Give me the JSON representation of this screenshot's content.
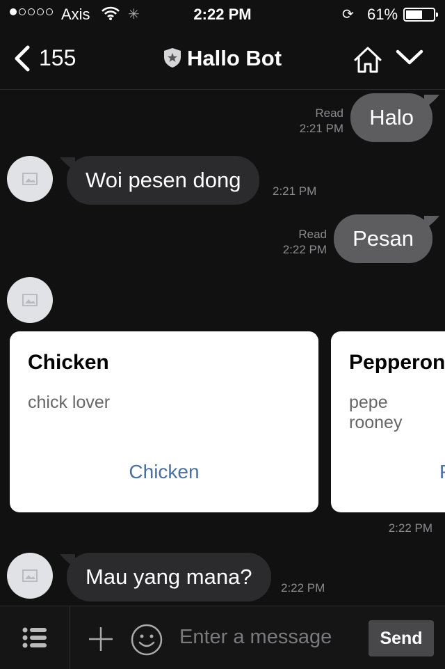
{
  "status_bar": {
    "carrier": "Axis",
    "time": "2:22 PM",
    "battery_percent": "61%",
    "battery_level": 0.61,
    "signal_bars": 1
  },
  "header": {
    "back_count": "155",
    "title": "Hallo Bot"
  },
  "messages": [
    {
      "from": "me",
      "text": "Halo",
      "status": "Read",
      "time": "2:21 PM"
    },
    {
      "from": "bot",
      "text": "Woi pesen dong",
      "time": "2:21 PM"
    },
    {
      "from": "me",
      "text": "Pesan",
      "status": "Read",
      "time": "2:22 PM"
    },
    {
      "from": "bot",
      "text": "Mau yang mana?",
      "time": "2:22 PM"
    }
  ],
  "carousel": {
    "time": "2:22 PM",
    "cards": [
      {
        "title": "Chicken",
        "description": "chick lover",
        "action": "Chicken"
      },
      {
        "title": "Pepperoni",
        "description": "pepe rooney",
        "action": "Pepperoni"
      }
    ]
  },
  "input": {
    "placeholder": "Enter a message",
    "send_label": "Send"
  },
  "colors": {
    "background": "#111112",
    "my_bubble": "#5d5d5f",
    "bot_bubble": "#2b2b2d",
    "link": "#4b6f9e"
  }
}
